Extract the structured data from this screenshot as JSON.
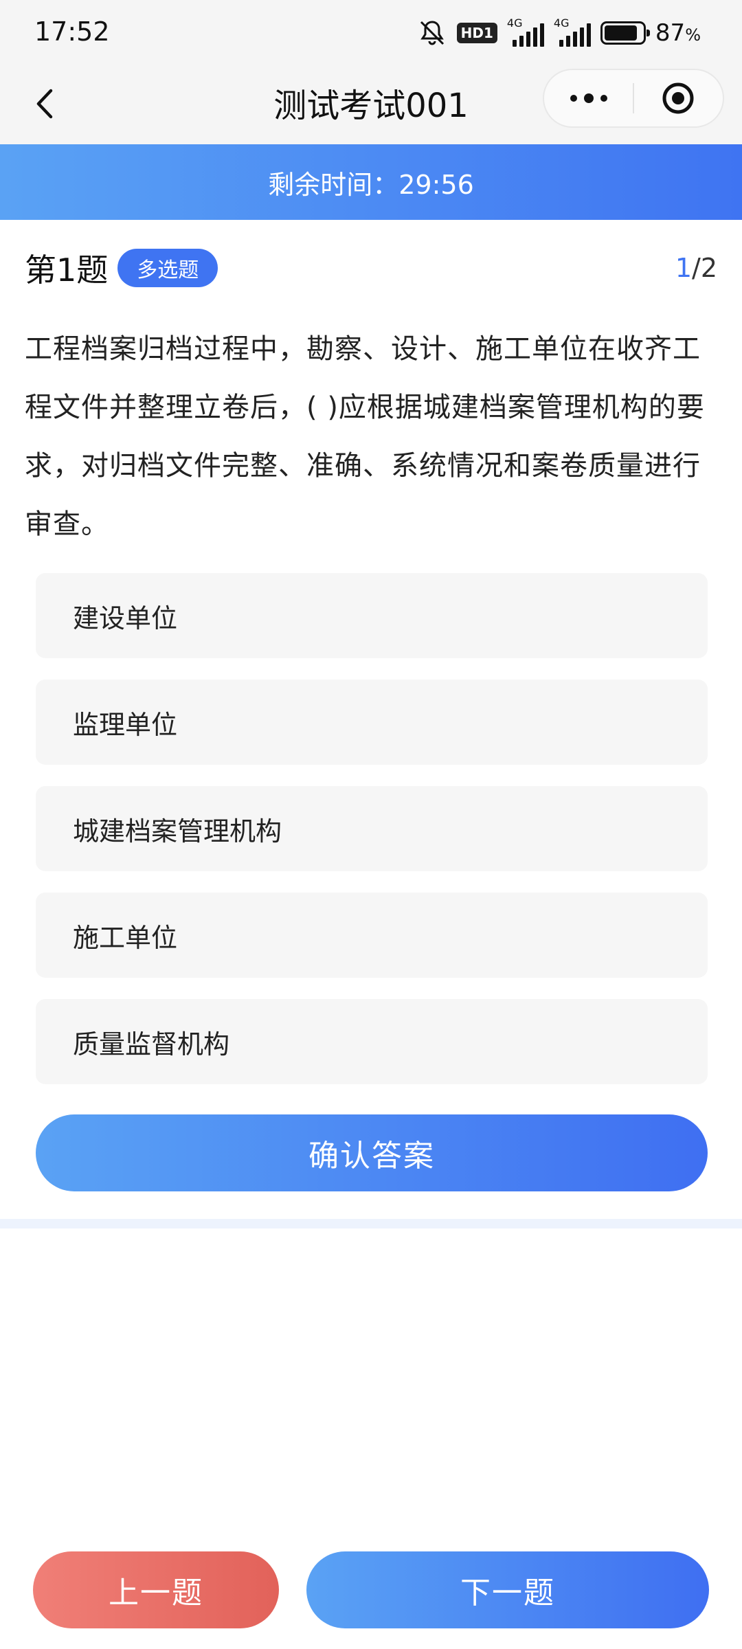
{
  "status_bar": {
    "time": "17:52",
    "network_badge": "HD1",
    "signal1_label": "4G",
    "signal2_label": "4G",
    "battery_percent": "87",
    "battery_unit": "%",
    "battery_level": 0.87
  },
  "nav": {
    "title": "测试考试001",
    "back_icon": "chevron-left-icon",
    "more_icon": "more-dots-icon",
    "close_icon": "target-close-icon"
  },
  "timer": {
    "text": "剩余时间：29:56"
  },
  "question": {
    "number_label": "第1题",
    "type_label": "多选题",
    "current": "1",
    "separator": "/",
    "total": "2",
    "text": "工程档案归档过程中，勘察、设计、施工单位在收齐工程文件并整理立卷后，( )应根据城建档案管理机构的要求，对归档文件完整、准确、系统情况和案卷质量进行审查。",
    "options": [
      {
        "label": "建设单位"
      },
      {
        "label": "监理单位"
      },
      {
        "label": "城建档案管理机构"
      },
      {
        "label": "施工单位"
      },
      {
        "label": "质量监督机构"
      }
    ]
  },
  "actions": {
    "confirm_label": "确认答案",
    "prev_label": "上一题",
    "next_label": "下一题"
  },
  "colors": {
    "accent": "#3f74f2",
    "accent_light": "#5aa2f4",
    "danger": "#e2625a",
    "option_bg": "#f6f6f6"
  }
}
